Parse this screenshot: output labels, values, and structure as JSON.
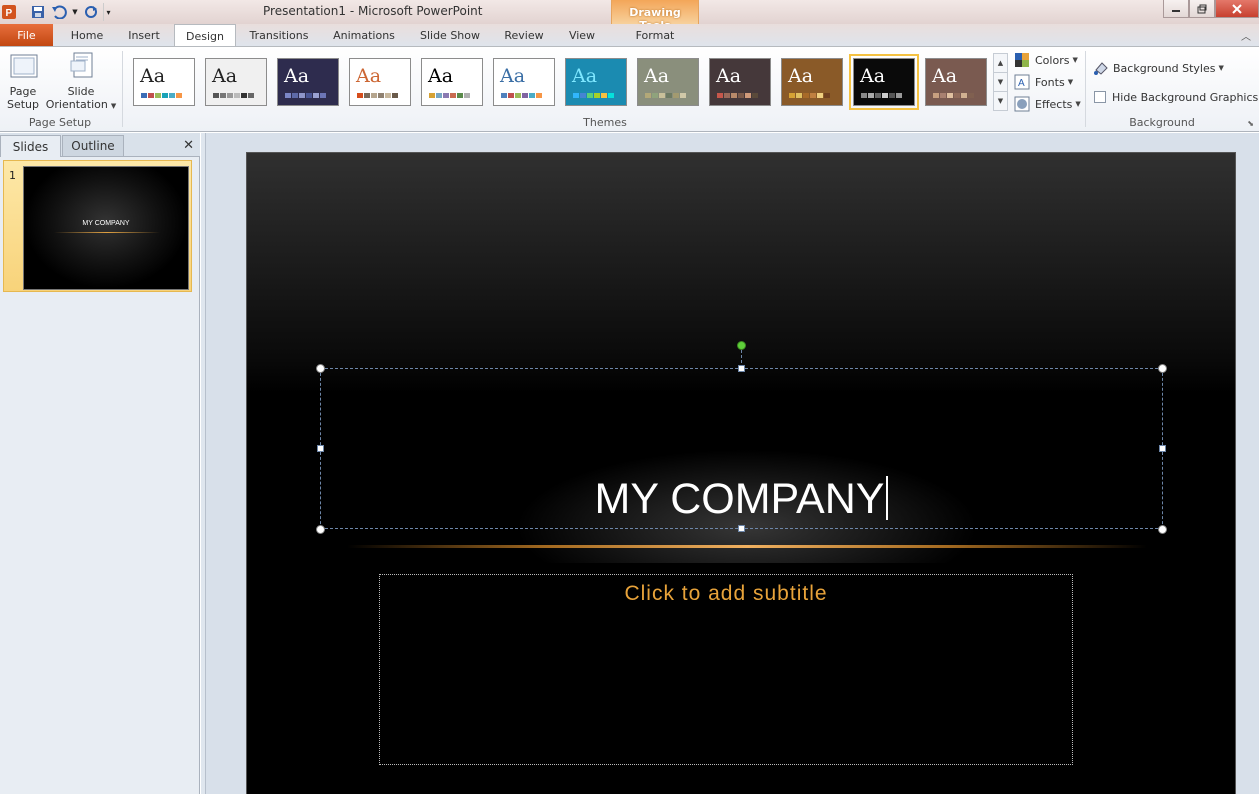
{
  "window": {
    "title": "Presentation1  -  Microsoft PowerPoint",
    "contextual_group": "Drawing Tools"
  },
  "tabs": [
    {
      "label": "File"
    },
    {
      "label": "Home"
    },
    {
      "label": "Insert"
    },
    {
      "label": "Design",
      "selected": true
    },
    {
      "label": "Transitions"
    },
    {
      "label": "Animations"
    },
    {
      "label": "Slide Show"
    },
    {
      "label": "Review"
    },
    {
      "label": "View"
    },
    {
      "label": "Format"
    }
  ],
  "ribbon": {
    "page_setup": {
      "group_label": "Page Setup",
      "page_setup_label_1": "Page",
      "page_setup_label_2": "Setup",
      "orientation_label_1": "Slide",
      "orientation_label_2": "Orientation"
    },
    "themes": {
      "group_label": "Themes",
      "items": [
        {
          "bg": "#ffffff",
          "text": "#222",
          "swatches": [
            "#3b6db6",
            "#c0504d",
            "#9bbb59",
            "#1aa3b7",
            "#4bacc6",
            "#f79646"
          ],
          "selected": false
        },
        {
          "bg": "#f0f0f0",
          "text": "#222",
          "swatches": [
            "#555",
            "#777",
            "#999",
            "#bbb",
            "#333",
            "#666"
          ],
          "selected": false
        },
        {
          "bg": "#2e2c4e",
          "text": "#fff",
          "swatches": [
            "#7b86c6",
            "#5e6aa8",
            "#8e95c9",
            "#4a5594",
            "#9aa1d2",
            "#6c75b6"
          ],
          "selected": false
        },
        {
          "bg": "#ffffff",
          "text": "#c63",
          "swatches": [
            "#d64d1c",
            "#7a6a5a",
            "#b5a58e",
            "#8f8171",
            "#c8b89e",
            "#6a5a4a"
          ],
          "selected": false
        },
        {
          "bg": "#ffffff",
          "text": "#000",
          "swatches": [
            "#d6a234",
            "#77a6c3",
            "#8a7ab2",
            "#c96b51",
            "#5a8a4a",
            "#b0b0b0"
          ],
          "selected": false
        },
        {
          "bg": "#ffffff",
          "text": "#3a6ea5",
          "swatches": [
            "#4f81bd",
            "#c0504d",
            "#9bbb59",
            "#8064a2",
            "#4bacc6",
            "#f79646"
          ],
          "selected": false
        },
        {
          "bg": "#1b8bb1",
          "text": "#7ee7ff",
          "swatches": [
            "#31b6fd",
            "#4584d3",
            "#5bd078",
            "#a5d028",
            "#f5c040",
            "#05e0db"
          ],
          "selected": false
        },
        {
          "bg": "#8a8f7c",
          "text": "#fff",
          "swatches": [
            "#b3a878",
            "#8fa37c",
            "#c9c09a",
            "#6d7a63",
            "#a29a70",
            "#d0c8a8"
          ],
          "selected": false
        },
        {
          "bg": "#45383a",
          "text": "#fff",
          "swatches": [
            "#c6574b",
            "#9a6a5a",
            "#b88a6a",
            "#7a5a4a",
            "#d09a7a",
            "#5a4a3a"
          ],
          "selected": false
        },
        {
          "bg": "#8a5a28",
          "text": "#fff",
          "swatches": [
            "#d6a234",
            "#e0c060",
            "#a86a28",
            "#c08040",
            "#f0d080",
            "#704020"
          ],
          "selected": false
        },
        {
          "bg": "#0a0a0a",
          "text": "#fff",
          "swatches": [
            "#888",
            "#aaa",
            "#666",
            "#ccc",
            "#555",
            "#999"
          ],
          "selected": true
        },
        {
          "bg": "#7a5a50",
          "text": "#fff",
          "swatches": [
            "#c8a080",
            "#a88070",
            "#e0c0a0",
            "#906a5a",
            "#d0b090",
            "#806050"
          ],
          "selected": false
        }
      ],
      "colors_label": "Colors",
      "fonts_label": "Fonts",
      "effects_label": "Effects"
    },
    "background": {
      "group_label": "Background",
      "styles_label": "Background Styles",
      "hide_graphics_label": "Hide Background Graphics",
      "hide_graphics_checked": false
    }
  },
  "left_pane": {
    "tabs": [
      {
        "label": "Slides"
      },
      {
        "label": "Outline"
      }
    ],
    "slides": [
      {
        "number": "1",
        "title": "MY COMPANY"
      }
    ]
  },
  "slide": {
    "title": "MY COMPANY",
    "subtitle_placeholder": "Click to add subtitle"
  },
  "colors": {
    "file_tab": "#d2541f",
    "subtitle_accent": "#e8a33a",
    "selection_glow": "#f5c242"
  }
}
